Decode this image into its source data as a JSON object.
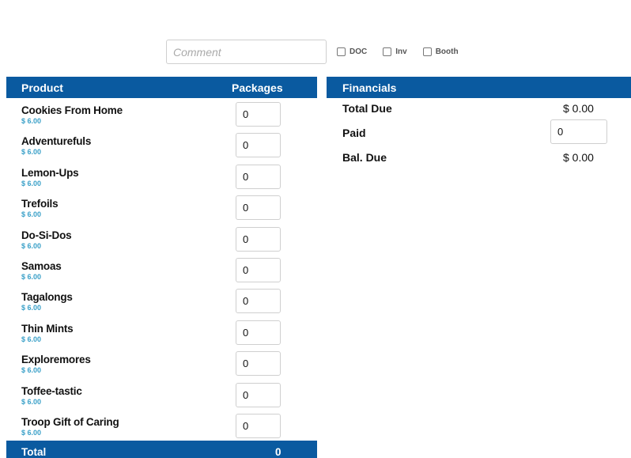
{
  "comment": {
    "placeholder": "Comment",
    "value": ""
  },
  "flags": [
    {
      "label": "DOC",
      "checked": false
    },
    {
      "label": "Inv",
      "checked": false
    },
    {
      "label": "Booth",
      "checked": false
    }
  ],
  "products_table": {
    "header_product": "Product",
    "header_packages": "Packages",
    "items": [
      {
        "name": "Cookies From Home",
        "price": "$ 6.00",
        "qty": "0"
      },
      {
        "name": "Adventurefuls",
        "price": "$ 6.00",
        "qty": "0"
      },
      {
        "name": "Lemon-Ups",
        "price": "$ 6.00",
        "qty": "0"
      },
      {
        "name": "Trefoils",
        "price": "$ 6.00",
        "qty": "0"
      },
      {
        "name": "Do-Si-Dos",
        "price": "$ 6.00",
        "qty": "0"
      },
      {
        "name": "Samoas",
        "price": "$ 6.00",
        "qty": "0"
      },
      {
        "name": "Tagalongs",
        "price": "$ 6.00",
        "qty": "0"
      },
      {
        "name": "Thin Mints",
        "price": "$ 6.00",
        "qty": "0"
      },
      {
        "name": "Exploremores",
        "price": "$ 6.00",
        "qty": "0"
      },
      {
        "name": "Toffee-tastic",
        "price": "$ 6.00",
        "qty": "0"
      },
      {
        "name": "Troop Gift of Caring",
        "price": "$ 6.00",
        "qty": "0"
      }
    ],
    "total_label": "Total",
    "total_value": "0"
  },
  "financials": {
    "header": "Financials",
    "total_due_label": "Total Due",
    "total_due_value": "$ 0.00",
    "paid_label": "Paid",
    "paid_value": "0",
    "bal_due_label": "Bal. Due",
    "bal_due_value": "$ 0.00"
  },
  "colors": {
    "header_blue": "#0a5aa0",
    "price_teal": "#3aa0c8"
  }
}
